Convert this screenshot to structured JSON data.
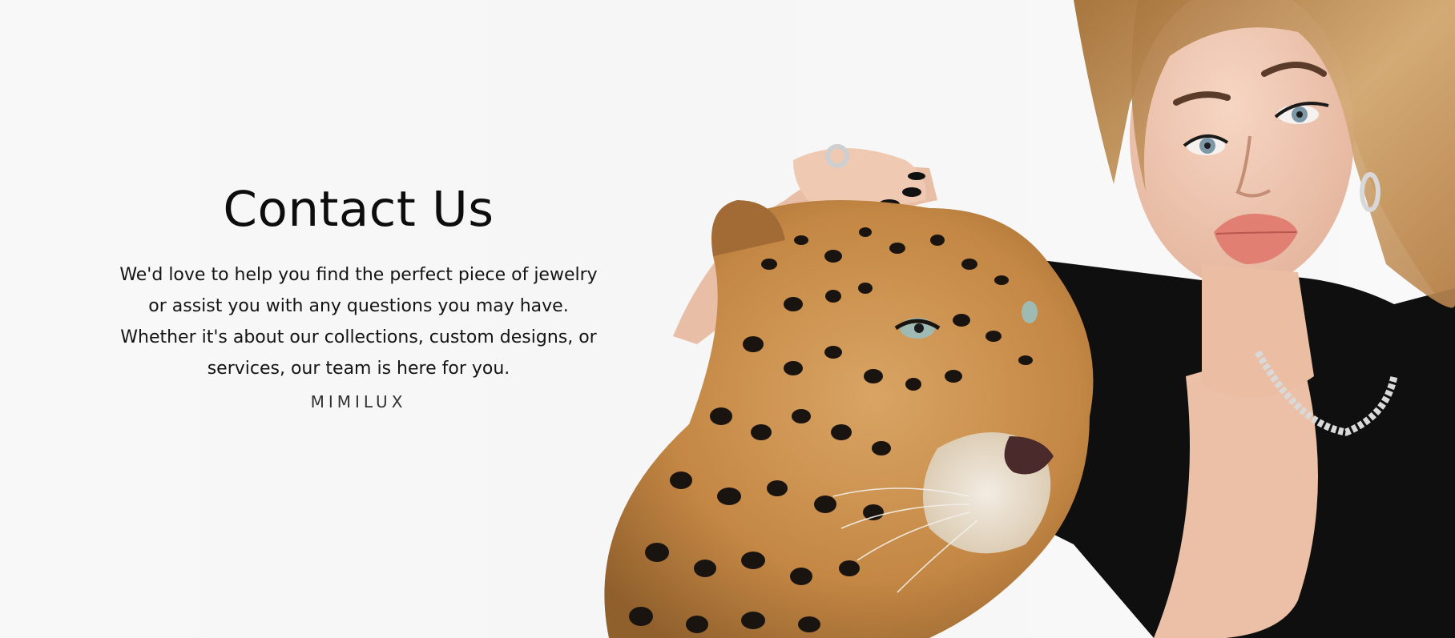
{
  "contact": {
    "title": "Contact Us",
    "body_lines": [
      "We'd love to help you find the perfect piece of jewelry",
      "or assist you with any questions you may have.",
      "Whether it's about our collections, custom designs, or",
      "services, our team is here for you."
    ],
    "brand": "MIMILUX"
  },
  "hero_image": {
    "subject": "woman-with-leopard",
    "colors": {
      "background": "#f7f7f7",
      "hair": "#c79a63",
      "skin": "#f1cbb5",
      "leopard_fur": "#c98b45",
      "spots": "#1a1410",
      "clothing": "#101010",
      "lips": "#e07f72"
    }
  }
}
